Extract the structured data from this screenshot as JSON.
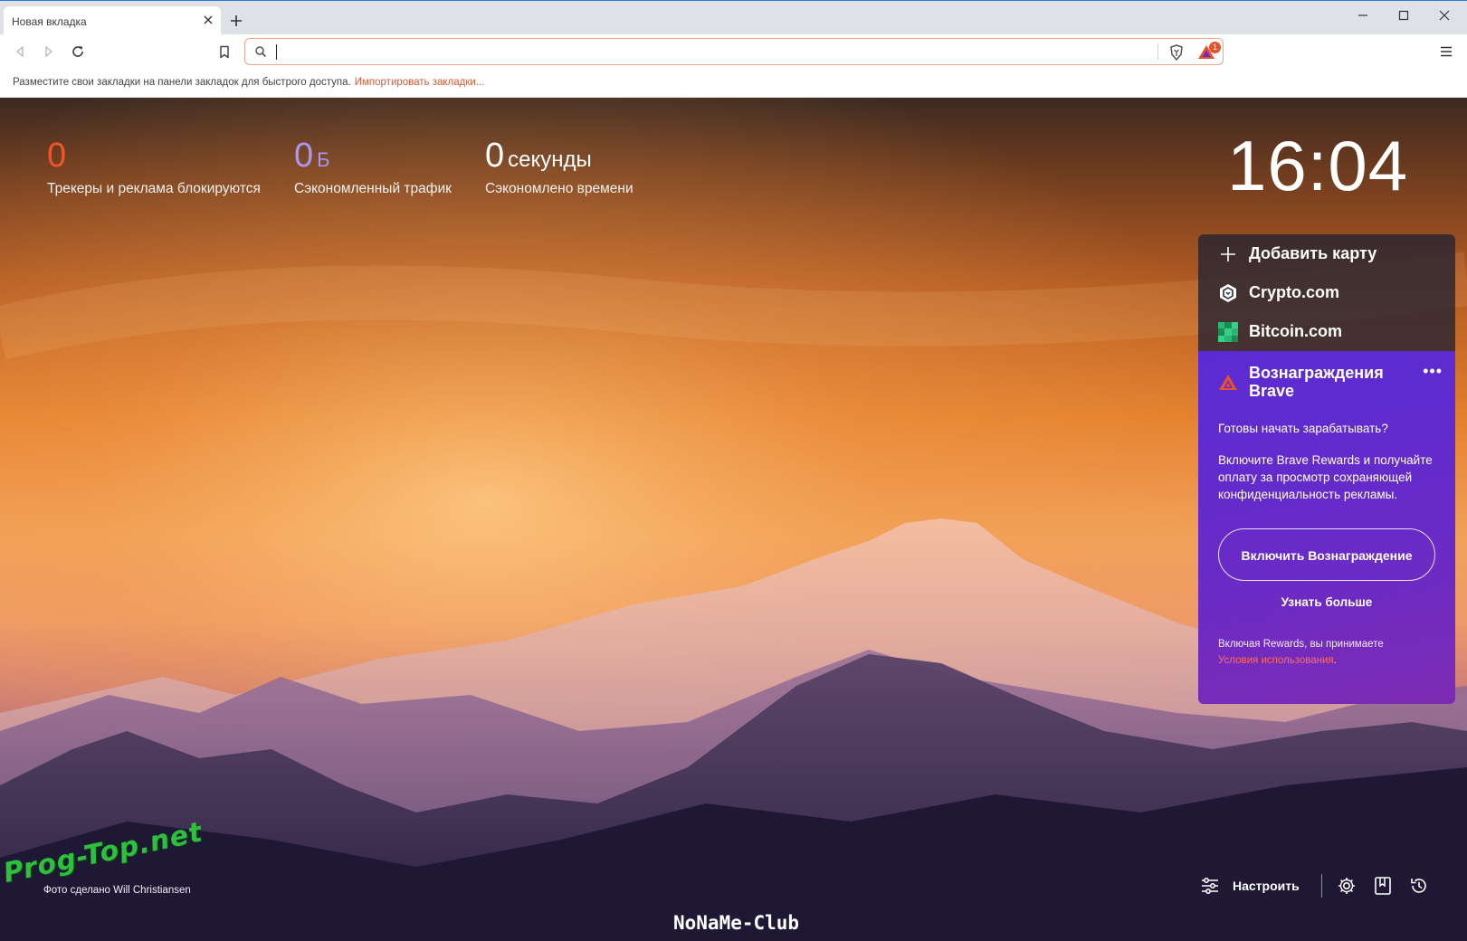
{
  "tab": {
    "title": "Новая вкладка"
  },
  "omnibox": {
    "value": "",
    "bat_badge": "1"
  },
  "bookmarks_bar": {
    "text": "Разместите свои закладки на панели закладок для быстрого доступа.",
    "link": "Импортировать закладки..."
  },
  "stats": {
    "trackers": {
      "value": "0",
      "label": "Трекеры и реклама блокируются"
    },
    "traffic": {
      "value": "0",
      "unit": "Б",
      "label": "Сэкономленный трафик"
    },
    "time": {
      "value": "0",
      "unit": "секунды",
      "label": "Сэкономлено времени"
    }
  },
  "clock": "16:04",
  "cards": {
    "add": "Добавить карту",
    "crypto": "Crypto.com",
    "bitcoin": "Bitcoin.com"
  },
  "rewards": {
    "title": "Вознаграждения Brave",
    "more": "•••",
    "question": "Готовы начать зарабатывать?",
    "description": "Включите Brave Rewards и получайте оплату за просмотр сохраняющей конфиденциальность рекламы.",
    "enable_button": "Включить Вознаграждение",
    "learn_more": "Узнать больше",
    "terms_prefix": "Включая Rewards, вы принимаете",
    "terms_link": "Условия использования",
    "terms_suffix": "."
  },
  "photo_credit": {
    "prefix": "Фото сделано",
    "author": "Will Christiansen"
  },
  "bottom": {
    "customize": "Настроить"
  },
  "watermarks": {
    "left": "Prog-Top.net",
    "bottom": "NoNaMe-Club"
  },
  "colors": {
    "accent": "#f0542b",
    "traffic": "#a995f2",
    "rewards": "#5a2bd4"
  }
}
